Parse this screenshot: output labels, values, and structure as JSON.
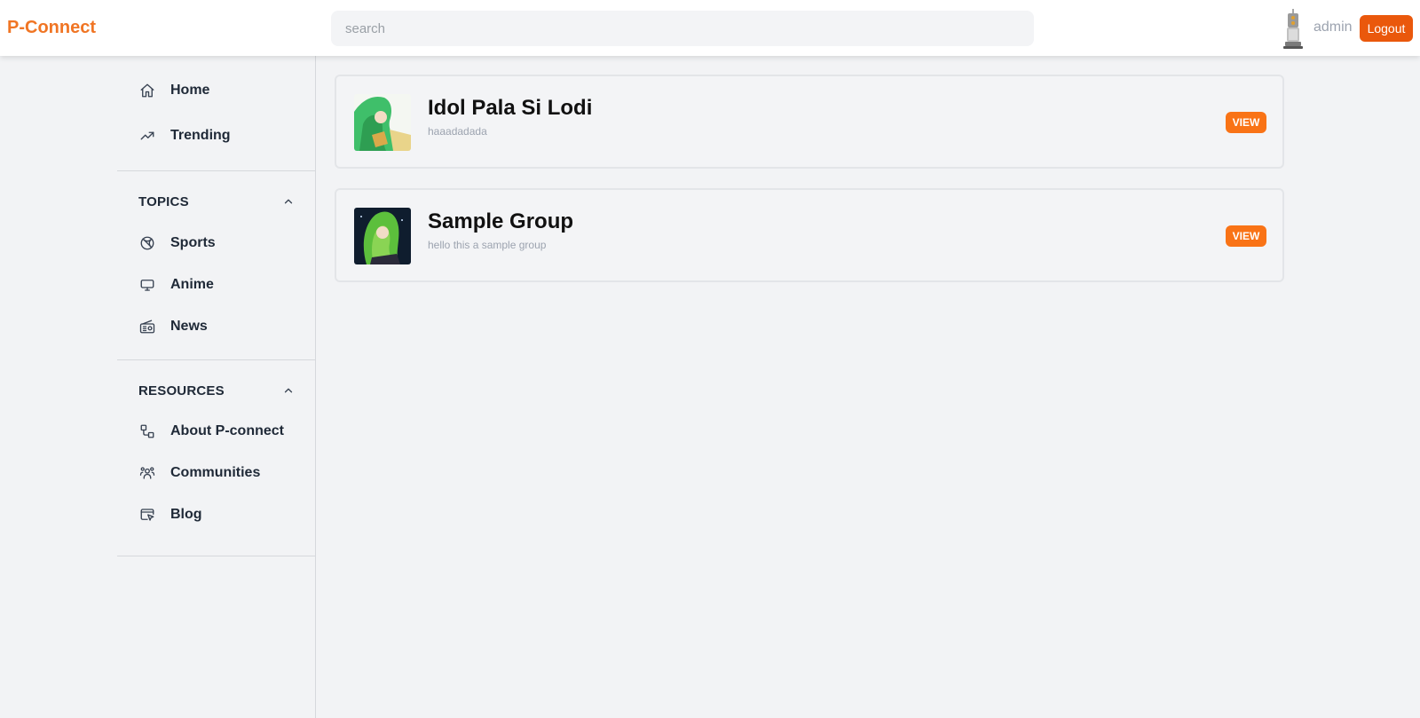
{
  "header": {
    "brand": "P-Connect",
    "search_placeholder": "search",
    "username": "admin",
    "logout_label": "Logout"
  },
  "sidebar": {
    "main_items": [
      {
        "label": "Home",
        "icon": "home-icon"
      },
      {
        "label": "Trending",
        "icon": "trending-icon"
      }
    ],
    "topics": {
      "title": "TOPICS",
      "items": [
        {
          "label": "Sports",
          "icon": "basketball-icon"
        },
        {
          "label": "Anime",
          "icon": "monitor-icon"
        },
        {
          "label": "News",
          "icon": "radio-icon"
        }
      ]
    },
    "resources": {
      "title": "RESOURCES",
      "items": [
        {
          "label": "About P-connect",
          "icon": "shapes-icon"
        },
        {
          "label": "Communities",
          "icon": "users-icon"
        },
        {
          "label": "Blog",
          "icon": "browser-pointer-icon"
        }
      ]
    }
  },
  "groups": [
    {
      "title": "Idol Pala Si Lodi",
      "description": "haaadadada",
      "action": "VIEW"
    },
    {
      "title": "Sample Group",
      "description": "hello this a sample group",
      "action": "VIEW"
    }
  ],
  "colors": {
    "brand": "#f07524",
    "logout": "#ea580c",
    "view_button": "#f97316",
    "background": "#f2f3f5"
  }
}
